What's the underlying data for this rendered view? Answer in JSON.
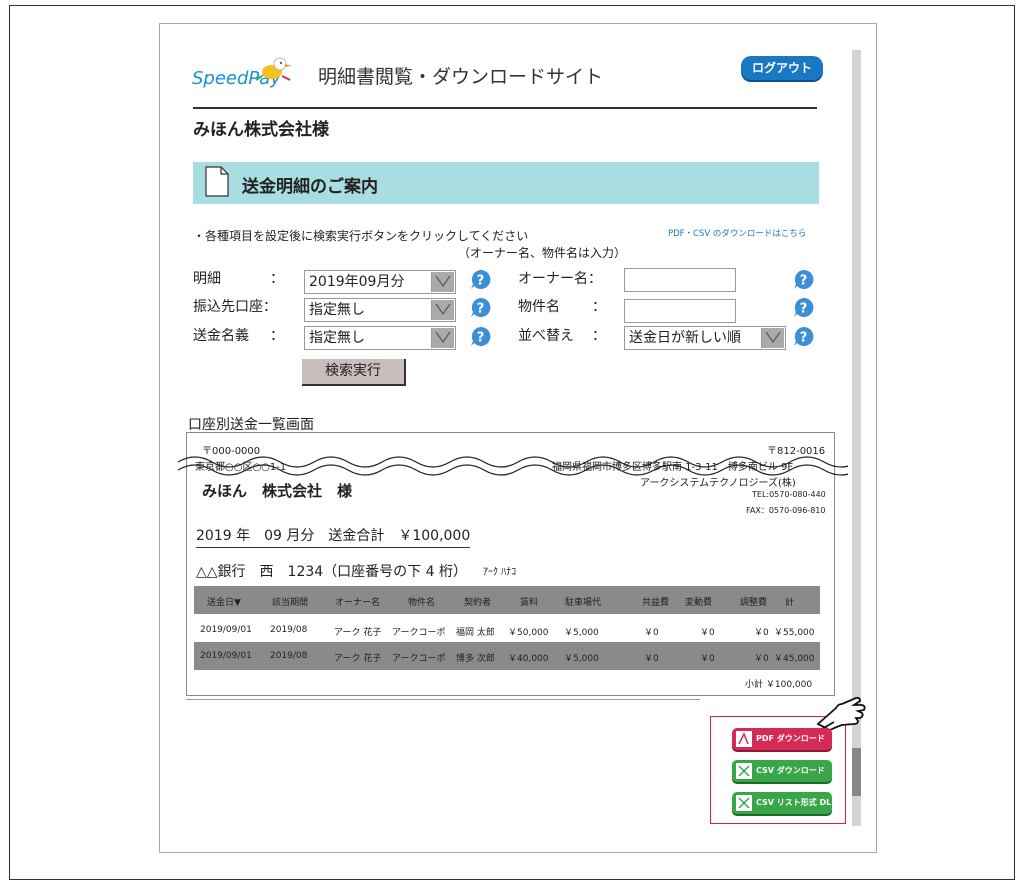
{
  "header": {
    "logo_text": "SpeedPay",
    "site_title": "明細書閲覧・ダウンロードサイト",
    "logout_label": "ログアウト",
    "company_name": "みほん株式会社様"
  },
  "section": {
    "title": "送金明細のご案内"
  },
  "instructions": {
    "line1": "・各種項目を設定後に検索実行ボタンをクリックしてください",
    "line2": "（オーナー名、物件名は入力）",
    "download_link": "PDF・CSV のダウンロードはこちら"
  },
  "form": {
    "meisai_label": "明細",
    "meisai_value": "2019年09月分",
    "account_label": "振込先口座：",
    "account_value": "指定無し",
    "sender_label": "送金名義",
    "sender_value": "指定無し",
    "owner_label": "オーナー名：",
    "owner_value": "",
    "property_label": "物件名",
    "property_value": "",
    "sort_label": "並べ替え",
    "sort_value": "送金日が新しい順",
    "colon": "："
  },
  "search_button": "検索実行",
  "list_title": "口座別送金一覧画面",
  "statement": {
    "recipient_zip": "〒000-0000",
    "recipient_address": "東京都○○区○○1-1",
    "recipient_name": "みほん　株式会社　様",
    "sender_zip": "〒812-0016",
    "sender_address": "福岡県福岡市博多区博多駅南 1-3-11　博多南ビル 9F",
    "sender_company": "アークシステムテクノロジーズ(株)",
    "sender_tel": "TEL:0570-080-440",
    "sender_fax": "FAX：0570-096-810",
    "period_total": "2019 年　09 月分　送金合計　￥100,000",
    "bank_line": "△△銀行　西　1234（口座番号の下 4 桁）",
    "bank_holder": "ｱｰｸ ﾊﾅｺ",
    "columns": [
      "送金日▼",
      "該当期間",
      "オーナー名",
      "物件名",
      "契約者",
      "賃料",
      "駐車場代",
      "共益費",
      "変動費",
      "調整費",
      "計"
    ],
    "rows": [
      [
        "2019/09/01",
        "2019/08",
        "アーク 花子",
        "アークコーポ",
        "福岡 太郎",
        "￥50,000",
        "￥5,000",
        "￥0",
        "￥0",
        "￥0",
        "￥55,000"
      ],
      [
        "2019/09/01",
        "2019/08",
        "アーク 花子",
        "アークコーポ",
        "博多 次郎",
        "￥40,000",
        "￥5,000",
        "￥0",
        "￥0",
        "￥0",
        "￥45,000"
      ]
    ],
    "subtotal_label": "小計",
    "subtotal_value": "￥100,000"
  },
  "downloads": {
    "pdf_label": "PDF ダウンロード",
    "csv_label": "CSV ダウンロード",
    "csv_list_label": "CSV リスト形式 DL"
  },
  "colors": {
    "section_bar": "#a8dde2",
    "logout": "#1a78c2",
    "pdf_button": "#d42a55",
    "csv_button": "#3aa64a",
    "highlight_border": "#e02030",
    "table_header": "#8a8a8a"
  }
}
